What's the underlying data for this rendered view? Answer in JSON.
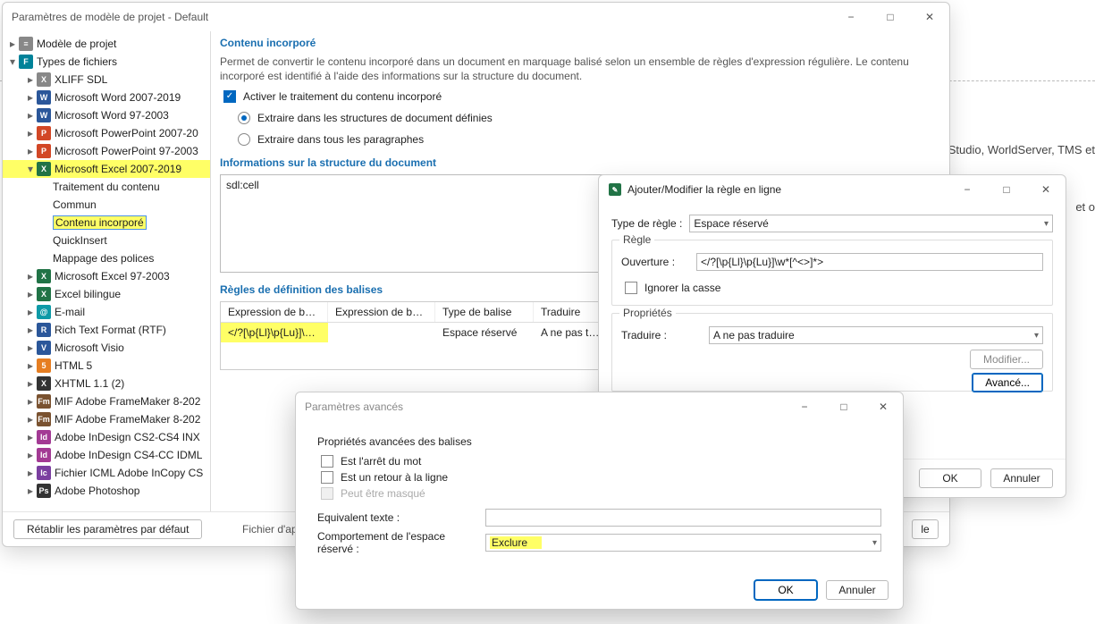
{
  "bg": {
    "text1": "Studio, WorldServer, TMS et",
    "text2": "et o"
  },
  "main": {
    "title": "Paramètres de modèle de projet - Default",
    "tree": {
      "root": "Modèle de projet",
      "types": "Types de fichiers",
      "items": [
        "XLIFF SDL",
        "Microsoft Word 2007-2019",
        "Microsoft Word 97-2003",
        "Microsoft PowerPoint 2007-20",
        "Microsoft PowerPoint 97-2003",
        "Microsoft Excel 2007-2019",
        "Traitement du contenu",
        "Commun",
        "Contenu incorporé",
        "QuickInsert",
        "Mappage des polices",
        "Microsoft Excel 97-2003",
        "Excel bilingue",
        "E-mail",
        "Rich Text Format (RTF)",
        "Microsoft Visio",
        "HTML 5",
        "XHTML 1.1 (2)",
        "MIF Adobe FrameMaker 8-202",
        "MIF Adobe FrameMaker 8-202",
        "Adobe InDesign CS2-CS4 INX",
        "Adobe InDesign CS4-CC IDML",
        "Fichier ICML Adobe InCopy CS",
        "Adobe Photoshop"
      ]
    },
    "content": {
      "section_title": "Contenu incorporé",
      "desc": "Permet de convertir le contenu incorporé dans un document en marquage balisé selon un ensemble de règles d'expression régulière. Le contenu incorporé est identifié à l'aide des informations sur la structure du document.",
      "chk_activate": "Activer le traitement du contenu incorporé",
      "radio_structures": "Extraire dans les structures de document définies",
      "radio_all": "Extraire dans tous les paragraphes",
      "info_title": "Informations sur la structure du document",
      "info_value": "sdl:cell",
      "rules_title": "Règles de définition des balises",
      "cols": [
        "Expression de bali…",
        "Expression de bali…",
        "Type de balise",
        "Traduire"
      ],
      "row": [
        "</?[\\p{Ll}\\p{Lu}]\\w*[…",
        "",
        "Espace réservé",
        "A ne pas t…"
      ]
    },
    "footer": {
      "reset": "Rétablir les paramètres par défaut",
      "preview": "Fichier d'aperçu",
      "le_btn": "le"
    }
  },
  "rule": {
    "title": "Ajouter/Modifier la règle en ligne",
    "type_label": "Type de règle :",
    "type_value": "Espace réservé",
    "group_rule": "Règle",
    "open_label": "Ouverture :",
    "open_value": "</?[\\p{Ll}\\p{Lu}]\\w*[^<>]*>",
    "ignore_case": "Ignorer la casse",
    "group_props": "Propriétés",
    "translate_label": "Traduire :",
    "translate_value": "A ne pas traduire",
    "modify": "Modifier...",
    "advanced": "Avancé...",
    "ok": "OK",
    "cancel": "Annuler"
  },
  "adv": {
    "title": "Paramètres avancés",
    "group": "Propriétés avancées des balises",
    "stopword": "Est l'arrêt du mot",
    "linebreak": "Est un retour à la ligne",
    "masked": "Peut être masqué",
    "equiv_label": "Equivalent texte :",
    "behav_label": "Comportement de l'espace réservé :",
    "behav_value": "Exclure",
    "ok": "OK",
    "cancel": "Annuler"
  }
}
